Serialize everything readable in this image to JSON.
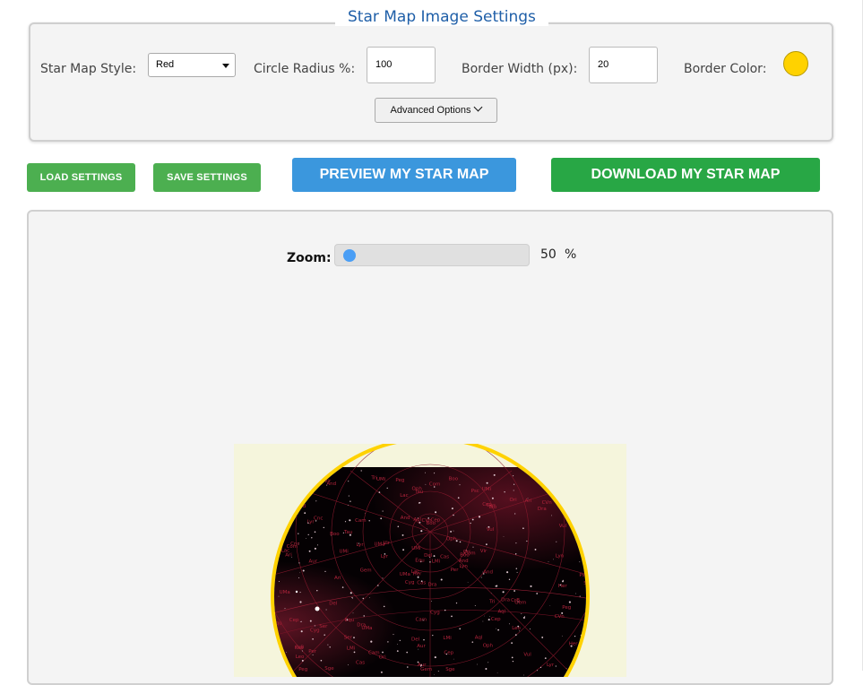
{
  "settings": {
    "legend": "Star Map Image Settings",
    "style_label": "Star Map Style:",
    "style_value": "Red",
    "radius_label": "Circle Radius %:",
    "radius_value": "100",
    "border_width_label": "Border Width (px):",
    "border_width_value": "20",
    "border_color_label": "Border Color:",
    "border_color": "#ffd200",
    "advanced_label": "Advanced Options"
  },
  "actions": {
    "load": "LOAD SETTINGS",
    "save": "SAVE SETTINGS",
    "preview": "PREVIEW MY STAR MAP",
    "download": "DOWNLOAD MY STAR MAP"
  },
  "preview": {
    "zoom_label": "Zoom:",
    "zoom_value": "50",
    "zoom_unit": "%",
    "zoom_fraction": 0.5
  },
  "colors": {
    "accent_blue": "#3b97dd",
    "accent_green": "#28a745",
    "small_button_green": "#4caf50",
    "legend_blue": "#1f5fa8",
    "map_background": "#f5f5dc",
    "map_sky": "#050103",
    "map_lines": "#8b1a2e"
  },
  "star_map_labels": [
    "Dra",
    "Lyr",
    "Her",
    "CrB",
    "Boo",
    "UMa",
    "UMi",
    "Cep",
    "Cas",
    "Per",
    "And",
    "Peg",
    "Aur",
    "Lyn",
    "Cyg",
    "Vul",
    "Sge",
    "Aql",
    "Oph",
    "Ser",
    "Vir",
    "Leo",
    "LMi",
    "CVn",
    "Com",
    "Gem",
    "Cnc",
    "Tau",
    "Ari",
    "Tri",
    "Psc",
    "Lac",
    "Del",
    "Equ",
    "Cam",
    "Ori"
  ]
}
